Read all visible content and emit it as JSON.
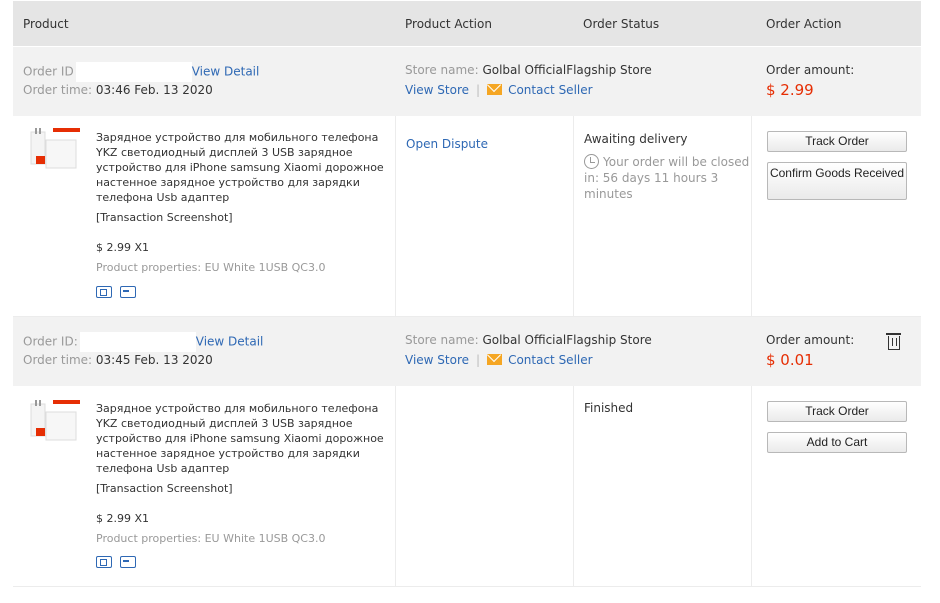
{
  "header": {
    "product": "Product",
    "product_action": "Product Action",
    "order_status": "Order Status",
    "order_action": "Order Action"
  },
  "orders": [
    {
      "order_id_label": "Order ID",
      "view_detail": "View Detail",
      "order_time_label": "Order time:",
      "order_time": "03:46 Feb. 13 2020",
      "store_label": "Store name:",
      "store_name": "Golbal OfficialFlagship Store",
      "view_store": "View Store",
      "contact_seller": "Contact Seller",
      "amount_label": "Order amount:",
      "amount": "$ 2.99",
      "product_title": "Зарядное устройство для мобильного телефона YKZ светодиодный дисплей 3 USB зарядное устройство для iPhone samsung Xiaomi дорожное настенное зарядное устройство для зарядки телефона Usb адаптер",
      "transaction": "[Transaction Screenshot]",
      "price_qty": "$ 2.99 X1",
      "properties": "Product properties: EU White 1USB QC3.0",
      "product_action": "Open Dispute",
      "status": "Awaiting delivery",
      "countdown": "Your order will be closed in: 56 days 11 hours 3 minutes",
      "button_1": "Track Order",
      "button_2": "Confirm Goods Received"
    },
    {
      "order_id_label": "Order ID:",
      "view_detail": "View Detail",
      "order_time_label": "Order time:",
      "order_time": "03:45 Feb. 13 2020",
      "store_label": "Store name:",
      "store_name": "Golbal OfficialFlagship Store",
      "view_store": "View Store",
      "contact_seller": "Contact Seller",
      "amount_label": "Order amount:",
      "amount": "$ 0.01",
      "product_title": "Зарядное устройство для мобильного телефона YKZ светодиодный дисплей 3 USB зарядное устройство для iPhone samsung Xiaomi дорожное настенное зарядное устройство для зарядки телефона Usb адаптер",
      "transaction": "[Transaction Screenshot]",
      "price_qty": "$ 2.99 X1",
      "properties": "Product properties: EU White 1USB QC3.0",
      "product_action": "",
      "status": "Finished",
      "button_1": "Track Order",
      "button_2": "Add to Cart"
    }
  ],
  "icons": {
    "mail": "mail-icon",
    "clock": "clock-icon",
    "trash": "trash-icon",
    "shipping": "shipping-icon",
    "payment": "payment-icon"
  }
}
